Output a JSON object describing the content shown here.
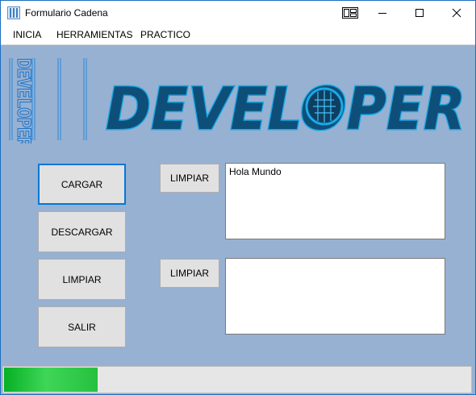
{
  "window": {
    "title": "Formulario Cadena"
  },
  "menu": {
    "items": [
      "INICIA",
      "HERRAMIENTAS",
      "PRACTICO"
    ]
  },
  "buttons": {
    "cargar": "CARGAR",
    "descargar": "DESCARGAR",
    "limpiar": "LIMPIAR",
    "salir": "SALIR",
    "limpiar_top": "LIMPIAR",
    "limpiar_bottom": "LIMPIAR"
  },
  "textboxes": {
    "top_value": "Hola Mundo",
    "bottom_value": ""
  },
  "progress": {
    "value_fraction": 0.2
  },
  "logos": {
    "banner_text": "DEVELOPER",
    "vertical_text": "DEVELOPER"
  },
  "colors": {
    "accent": "#0078d7",
    "background": "#97b1d2",
    "logo_cyan": "#1aa9e6",
    "progress_green": "#06b025"
  }
}
